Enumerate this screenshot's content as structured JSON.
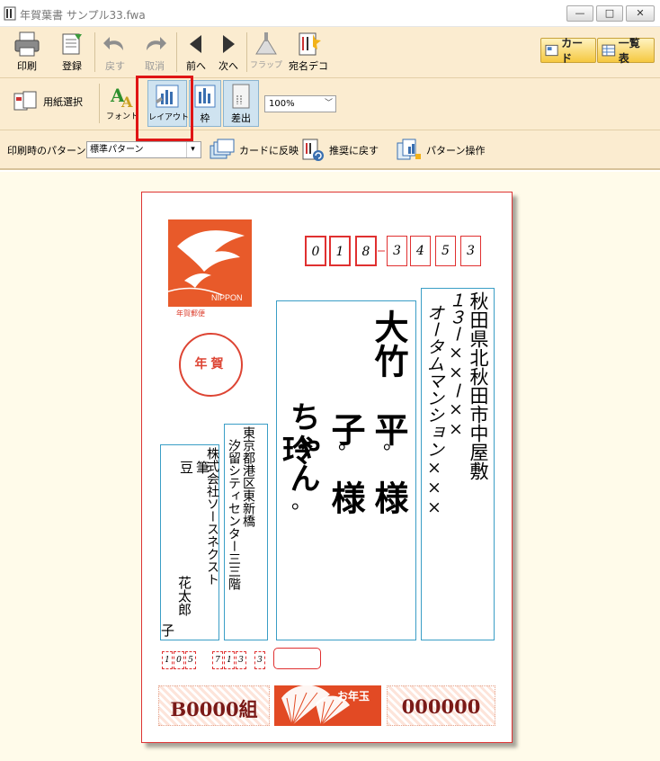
{
  "window": {
    "title": "年賀葉書  サンプル33.fwa",
    "minimize": "—",
    "maximize": "□",
    "close": "✕"
  },
  "toolbar1": {
    "print": "印刷",
    "register": "登録",
    "undo": "戻す",
    "cancel": "取消",
    "prev": "前へ",
    "next": "次へ",
    "flap": "フラップ",
    "address_deco": "宛名デコ",
    "card_view": "カード",
    "list_view": "一覧表"
  },
  "toolbar2": {
    "paper_select": "用紙選択",
    "font": "フォント",
    "layout": "レイアウト",
    "frame": "枠",
    "sender": "差出",
    "zoom": "100%"
  },
  "toolbar3": {
    "pattern_label": "印刷時のパターン",
    "pattern_value": "標準パターン",
    "apply_card": "カードに反映",
    "reset_recommended": "推奨に戻す",
    "pattern_ops": "パターン操作"
  },
  "postcard": {
    "zip_digits": [
      "0",
      "1",
      "8",
      "3",
      "4",
      "5",
      "3"
    ],
    "stamp_caption": "年賀郵便",
    "stamp_brand": "NIPPON",
    "nenga": "年賀",
    "recipient_address_1": "秋田県北秋田市中屋敷",
    "recipient_address_2": "１３ー××ー××",
    "recipient_address_3": "オータムマンション×××",
    "recipient_name_1": "大竹　平　様",
    "recipient_name_2": "　　　子　様",
    "recipient_name_3": "　　　ちゃん",
    "recipient_given_1": "玲",
    "recipient_given_mid": "。",
    "sender_address_1": "東京都港区東新橋",
    "sender_address_2": "汐留シティセンター三三階",
    "sender_company": "株式会社ソースネクスト",
    "sender_name_1": "筆　豆",
    "sender_name_2": "花太郎",
    "sender_name_3": "子",
    "sender_zip": [
      "1",
      "0",
      "5",
      "7",
      "1",
      "3",
      "3"
    ],
    "lottery_group": "B0000組",
    "lottery_number": "000000",
    "otoshidama": "お年玉"
  },
  "colors": {
    "toolbar_bg": "#fbecd0",
    "canvas_bg": "#fffbea",
    "zip_red": "#e03030",
    "frame_blue": "#3a9ec6",
    "highlight": "#e01515"
  }
}
